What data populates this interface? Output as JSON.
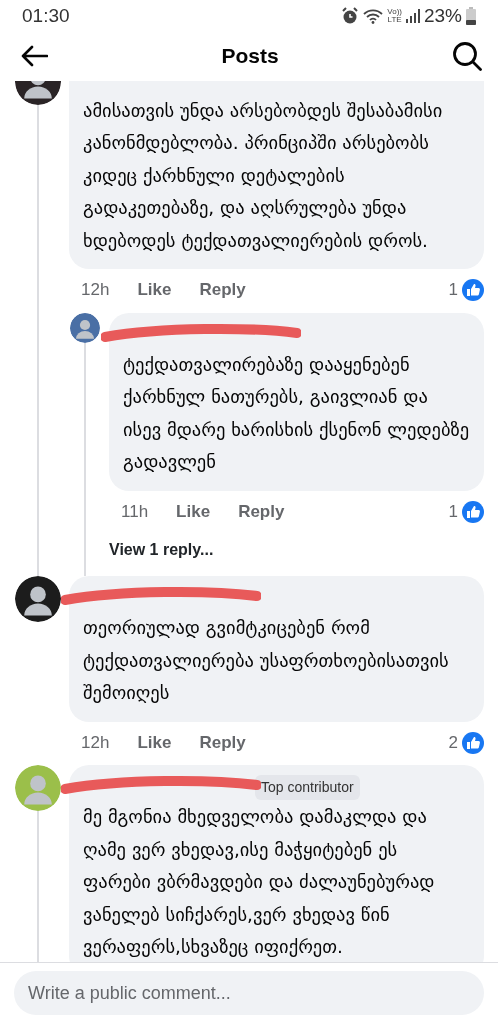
{
  "status_bar": {
    "time": "01:30",
    "network": [
      "Vo))",
      "LTE"
    ],
    "battery": "23%"
  },
  "header": {
    "title": "Posts"
  },
  "comments": [
    {
      "redacted": false,
      "thread_line": true,
      "text": "ამისათვის უნდა არსებობდეს შესაბამისი კანონმდებლობა. პრინციპში არსებობს კიდეც ქარხნული დეტალების გადაკეთებაზე, და აღსრულება უნდა ხდებოდეს ტექდათვალიერების დროს.",
      "time": "12h",
      "like": "Like",
      "reply": "Reply",
      "likes": "1",
      "replies": [
        {
          "redacted": true,
          "thread_line": true,
          "text": "ტექდათვალირებაზე დააყენებენ ქარხნულ ნათურებს, გაივლიან და ისევ მდარე ხარისხის ქსენონ ლედებზე გადავლენ",
          "time": "11h",
          "like": "Like",
          "reply": "Reply",
          "likes": "1",
          "view_more": "View 1 reply..."
        }
      ]
    },
    {
      "redacted": true,
      "thread_line": false,
      "text": "თეორიულად გვიმტკიცებენ რომ ტექდათვალიერება უსაფრთხოებისათვის შემოიღეს",
      "time": "12h",
      "like": "Like",
      "reply": "Reply",
      "likes": "2"
    },
    {
      "redacted": true,
      "badge": "Top contributor",
      "thread_line": true,
      "text": "მე მგონია მხედველობა დამაკლდა და ღამე ვერ ვხედავ,ისე მაჭყიტებენ ეს ფარები ვბრმავდები და ძალაუნებურად ვანელებ სიჩქარეს,ვერ ვხედავ წინ ვერაფერს,სხვაზეც იფიქრეთ."
    }
  ],
  "composer": {
    "placeholder": "Write a public comment..."
  }
}
